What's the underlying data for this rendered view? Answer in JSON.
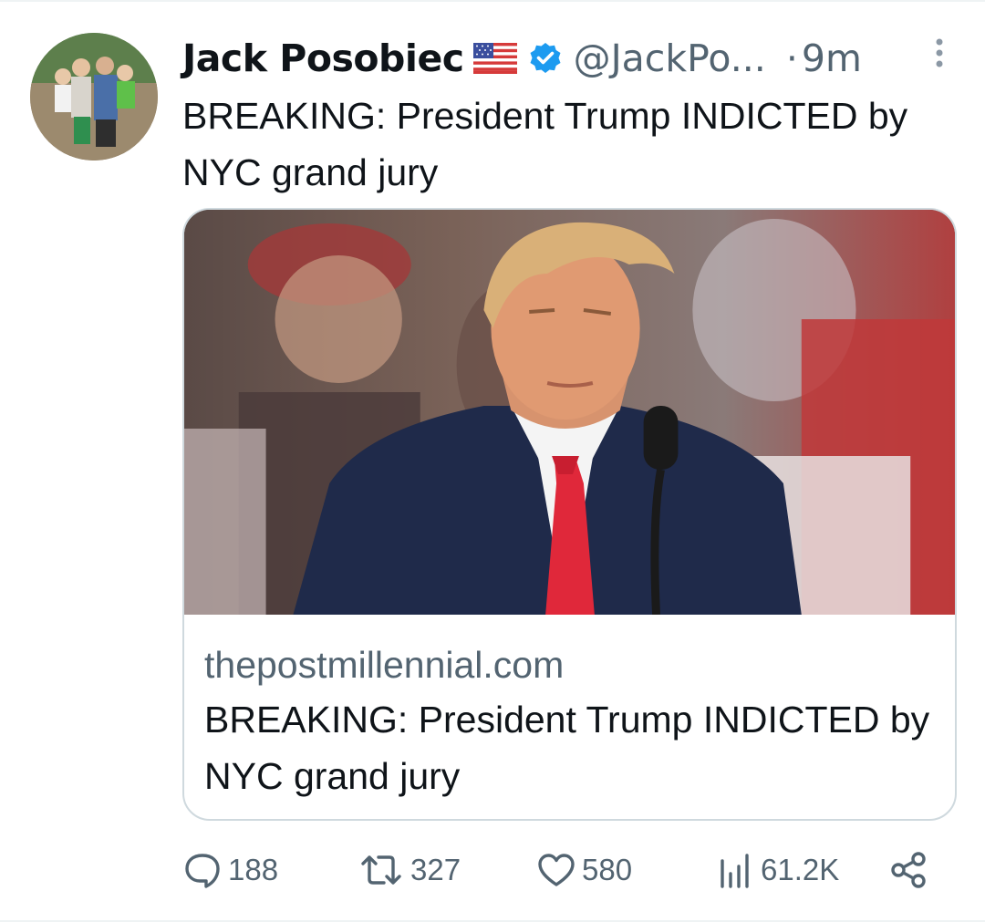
{
  "tweet": {
    "author_name": "Jack Posobiec",
    "handle": "@JackPo...",
    "separator": "·",
    "time": "9m",
    "text": "BREAKING: President Trump INDICTED by NYC grand jury",
    "card": {
      "domain": "thepostmillennial.com",
      "title": "BREAKING: President Trump INDICTED by NYC grand jury"
    },
    "actions": {
      "replies": "188",
      "retweets": "327",
      "likes": "580",
      "views": "61.2K"
    }
  },
  "colors": {
    "verified": "#1d9bf0",
    "secondary_text": "#536471",
    "card_border": "#cfd9de"
  },
  "icons": {
    "more": "more-vertical-icon",
    "reply": "speech-bubble-icon",
    "retweet": "retweet-arrows-icon",
    "like": "heart-icon",
    "views": "bar-chart-icon",
    "share": "share-icon"
  }
}
